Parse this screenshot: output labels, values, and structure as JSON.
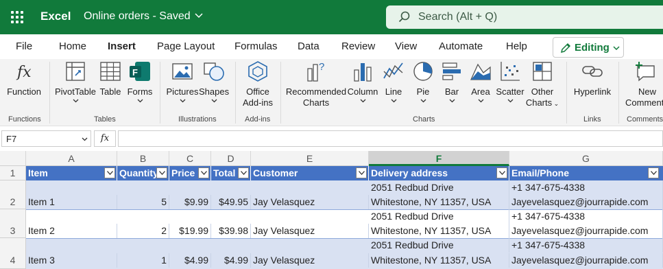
{
  "app": {
    "name": "Excel",
    "document": "Online orders - Saved"
  },
  "search": {
    "placeholder": "Search (Alt + Q)"
  },
  "menu": {
    "tabs": [
      "File",
      "Home",
      "Insert",
      "Page Layout",
      "Formulas",
      "Data",
      "Review",
      "View",
      "Automate",
      "Help"
    ],
    "active": "Insert",
    "editing_label": "Editing"
  },
  "ribbon": {
    "buttons": {
      "function": "Function",
      "pivottable": "PivotTable",
      "table": "Table",
      "forms": "Forms",
      "pictures": "Pictures",
      "shapes": "Shapes",
      "office_addins_1": "Office",
      "office_addins_2": "Add-ins",
      "recommended_1": "Recommended",
      "recommended_2": "Charts",
      "column": "Column",
      "line": "Line",
      "pie": "Pie",
      "bar": "Bar",
      "area": "Area",
      "scatter": "Scatter",
      "other_1": "Other",
      "other_2": "Charts",
      "hyperlink": "Hyperlink",
      "new_comment_1": "New",
      "new_comment_2": "Comment"
    },
    "groups": {
      "functions": "Functions",
      "tables": "Tables",
      "illustrations": "Illustrations",
      "addins": "Add-ins",
      "charts": "Charts",
      "links": "Links",
      "comments": "Comments"
    }
  },
  "formula_bar": {
    "cell_ref": "F7",
    "fx": "fx",
    "value": ""
  },
  "sheet": {
    "columns": [
      "A",
      "B",
      "C",
      "D",
      "E",
      "F",
      "G"
    ],
    "selected_column": "F",
    "rows": [
      "1",
      "2",
      "3",
      "4"
    ],
    "headers": [
      "Item",
      "Quantity",
      "Price",
      "Total",
      "Customer",
      "Delivery address",
      "Email/Phone"
    ],
    "data": [
      {
        "item": "Item 1",
        "qty": "5",
        "price": "$9.99",
        "total": "$49.95",
        "customer": "Jay Velasquez",
        "addr1": "2051 Redbud Drive",
        "addr2": "Whitestone, NY 11357, USA",
        "phone": "+1 347-675-4338",
        "email": "Jayevelasquez@jourrapide.com"
      },
      {
        "item": "Item 2",
        "qty": "2",
        "price": "$19.99",
        "total": "$39.98",
        "customer": "Jay Velasquez",
        "addr1": "2051 Redbud Drive",
        "addr2": "Whitestone, NY 11357, USA",
        "phone": "+1 347-675-4338",
        "email": "Jayevelasquez@jourrapide.com"
      },
      {
        "item": "Item 3",
        "qty": "1",
        "price": "$4.99",
        "total": "$4.99",
        "customer": "Jay Velasquez",
        "addr1": "2051 Redbud Drive",
        "addr2": "Whitestone, NY 11357, USA",
        "phone": "+1 347-675-4338",
        "email": "Jayevelasquez@jourrapide.com"
      }
    ]
  },
  "colors": {
    "brand": "#117a3b",
    "table_header": "#4472c4",
    "band": "#d9e1f2"
  }
}
